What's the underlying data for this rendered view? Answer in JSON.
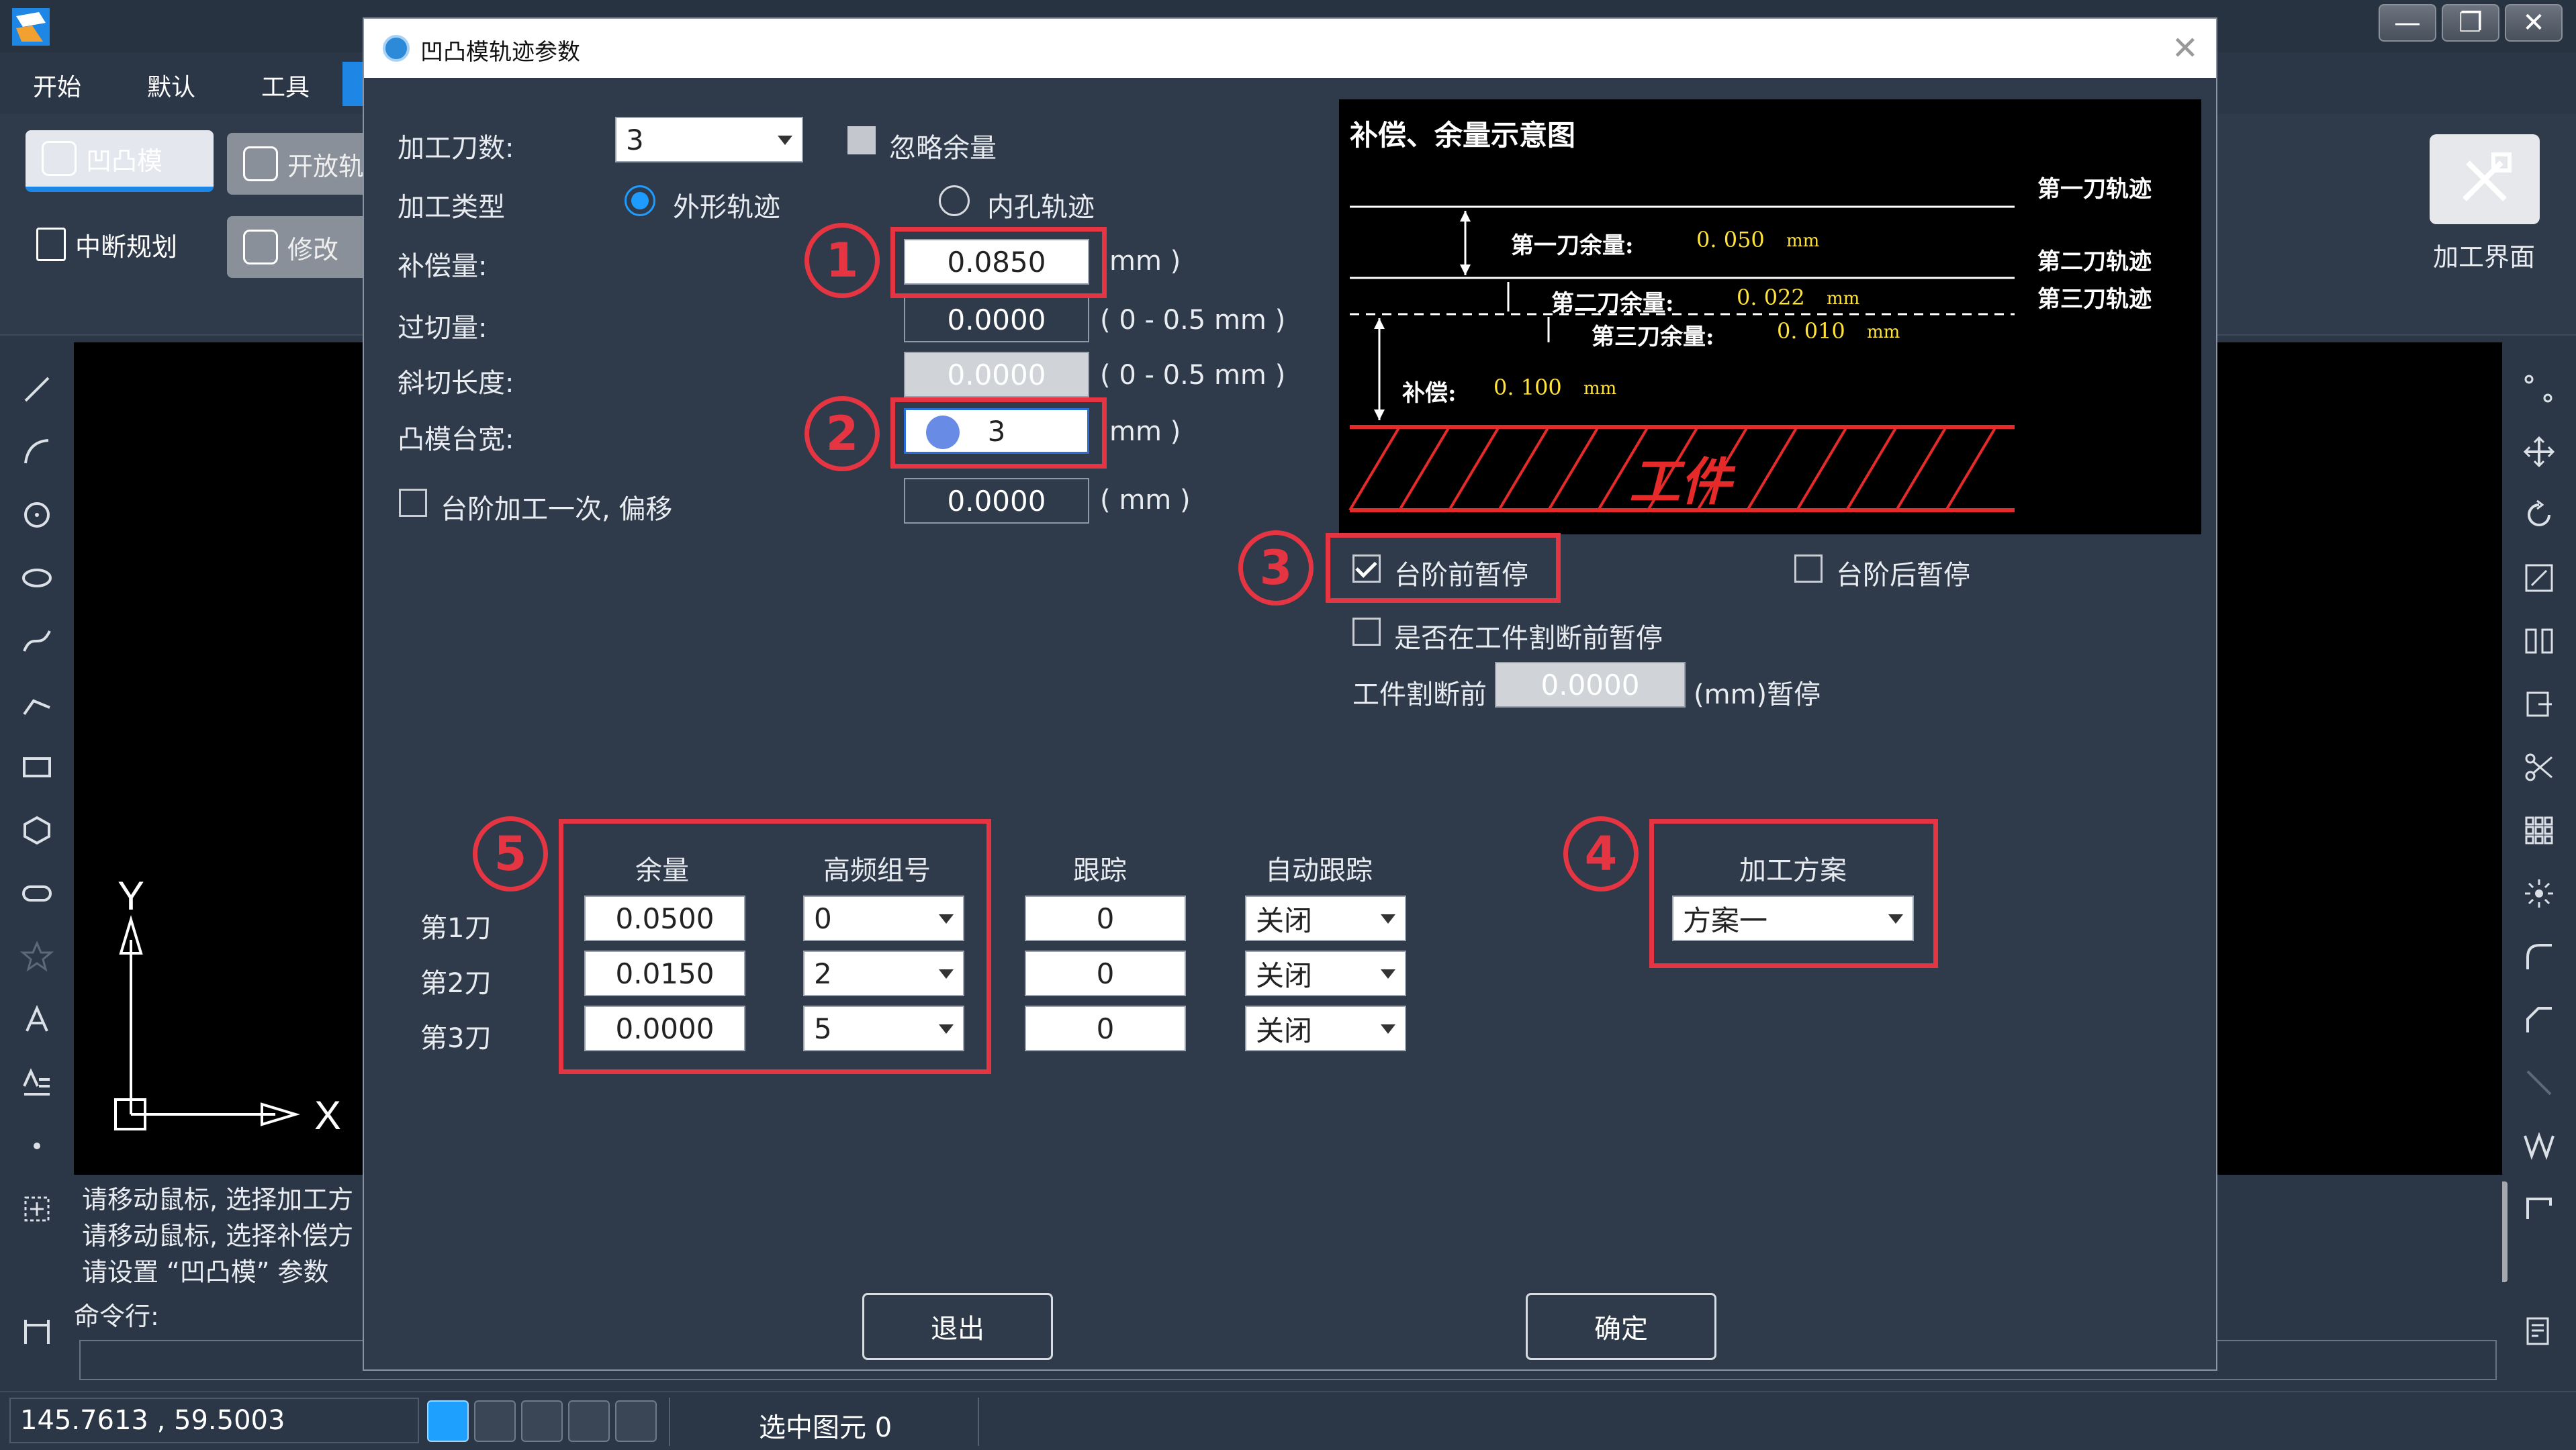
{
  "app": {
    "menu": [
      "开始",
      "默认",
      "工具"
    ],
    "ribbon": {
      "b1": "凹凸模",
      "b2": "开放轨",
      "b3": "中断规划",
      "b4": "修改",
      "big_label": "加工界面"
    }
  },
  "dialog": {
    "title": "凹凸模轨迹参数",
    "labels": {
      "tool_count": "加工刀数:",
      "process_type": "加工类型",
      "compensation": "补偿量:",
      "overcut": "过切量:",
      "bevel": "斜切长度:",
      "boss_width": "凸模台宽:",
      "step_once": "台阶加工一次, 偏移"
    },
    "tool_count": "3",
    "ignore_allowance": "忽略余量",
    "radio_outer": "外形轨迹",
    "radio_inner": "内孔轨迹",
    "compensation": "0.0850",
    "overcut": "0.0000",
    "bevel": "0.0000",
    "boss_width": "3",
    "step_offset": "0.0000",
    "unit_mm": "mm )",
    "unit_range": "( 0 - 0.5 mm )",
    "unit_paren_mm": "( mm )",
    "pause_before_step": "台阶前暂停",
    "pause_after_step": "台阶后暂停",
    "pause_before_cut": "是否在工件割断前暂停",
    "cut_before": "工件割断前",
    "cut_before_value": "0.0000",
    "cut_before_unit": "(mm)暂停",
    "table": {
      "headers": [
        "余量",
        "高频组号",
        "跟踪",
        "自动跟踪"
      ],
      "rows": [
        {
          "name": "第1刀",
          "allowance": "0.0500",
          "group": "0",
          "track": "0",
          "auto": "关闭"
        },
        {
          "name": "第2刀",
          "allowance": "0.0150",
          "group": "2",
          "track": "0",
          "auto": "关闭"
        },
        {
          "name": "第3刀",
          "allowance": "0.0000",
          "group": "5",
          "track": "0",
          "auto": "关闭"
        }
      ]
    },
    "scheme_label": "加工方案",
    "scheme_value": "方案一",
    "exit": "退出",
    "ok": "确定",
    "annotations": [
      "1",
      "2",
      "3",
      "4",
      "5"
    ],
    "diagram": {
      "title": "补偿、余量示意图",
      "track1": "第一刀轨迹",
      "track2": "第二刀轨迹",
      "track3": "第三刀轨迹",
      "a1_label": "第一刀余量:",
      "a1_value": "0. 050",
      "a2_label": "第二刀余量:",
      "a2_value": "0. 022",
      "a3_label": "第三刀余量:",
      "a3_value": "0. 010",
      "comp_label": "补偿:",
      "comp_value": "0. 100",
      "unit": "mm",
      "workpiece": "工件"
    }
  },
  "cmd": {
    "line1": "请移动鼠标, 选择加工方",
    "line2": "请移动鼠标, 选择补偿方",
    "line3": "请设置 “凹凸模” 参数",
    "prompt": "命令行:"
  },
  "status": {
    "coords": "145.7613 , 59.5003",
    "selected": "选中图元 0"
  },
  "axes": {
    "x": "X",
    "y": "Y"
  },
  "colors": {
    "accent": "#1e9bff",
    "annotation_red": "#e63542",
    "diagram_yellow": "#ffe23a"
  }
}
